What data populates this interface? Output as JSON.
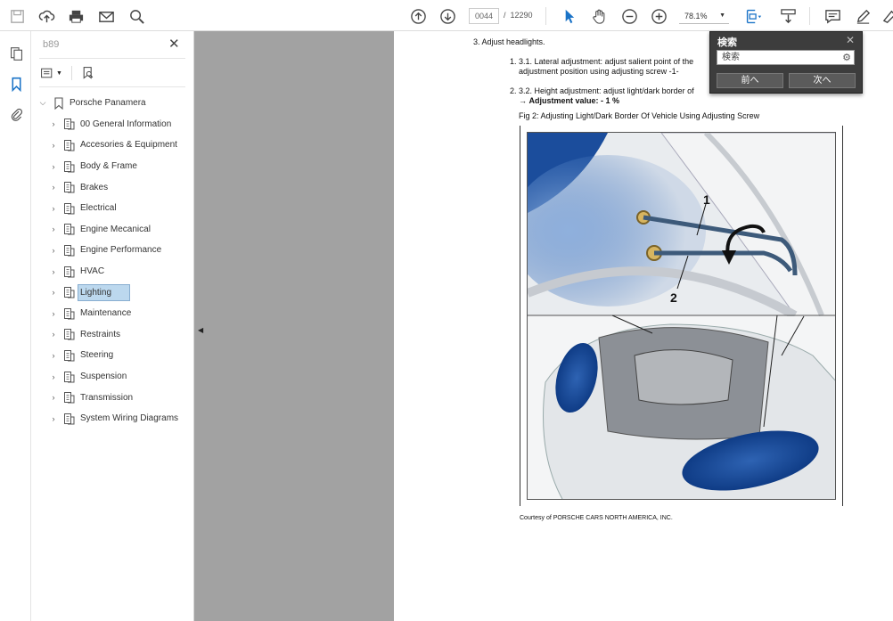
{
  "toolbar": {
    "current_page": "0044",
    "page_separator": "/",
    "total_pages": "12290",
    "zoom": "78.1%"
  },
  "panel": {
    "title": "b89",
    "root": "Porsche Panamera",
    "items": [
      {
        "label": "00 General Information"
      },
      {
        "label": "Accesories & Equipment"
      },
      {
        "label": "Body & Frame"
      },
      {
        "label": "Brakes"
      },
      {
        "label": "Electrical"
      },
      {
        "label": "Engine Mecanical"
      },
      {
        "label": "Engine Performance"
      },
      {
        "label": "HVAC"
      },
      {
        "label": "Lighting"
      },
      {
        "label": "Maintenance"
      },
      {
        "label": "Restraints"
      },
      {
        "label": "Steering"
      },
      {
        "label": "Suspension"
      },
      {
        "label": "Transmission"
      },
      {
        "label": "System Wiring Diagrams"
      }
    ],
    "selected": "Lighting"
  },
  "document": {
    "step3": "3. Adjust headlights.",
    "step31a": "1. 3.1. Lateral adjustment: adjust salient point of the",
    "step31b": "adjustment position using adjusting screw -1-",
    "step32a": "2. 3.2. Height adjustment: adjust light/dark border of",
    "step32b_arrow": "→",
    "step32b_label": "Adjustment value:",
    "step32b_value": "- 1 %",
    "fig_caption": "Fig 2: Adjusting Light/Dark Border Of Vehicle Using Adjusting Screw",
    "callout_1": "1",
    "callout_2": "2",
    "courtesy": "Courtesy of PORSCHE CARS NORTH AMERICA, INC."
  },
  "search": {
    "title": "検索",
    "query": "検索",
    "prev_label": "前へ",
    "next_label": "次へ"
  },
  "icons": {
    "accent": "#1a73c7",
    "selected_bg": "#bcd8ee"
  }
}
